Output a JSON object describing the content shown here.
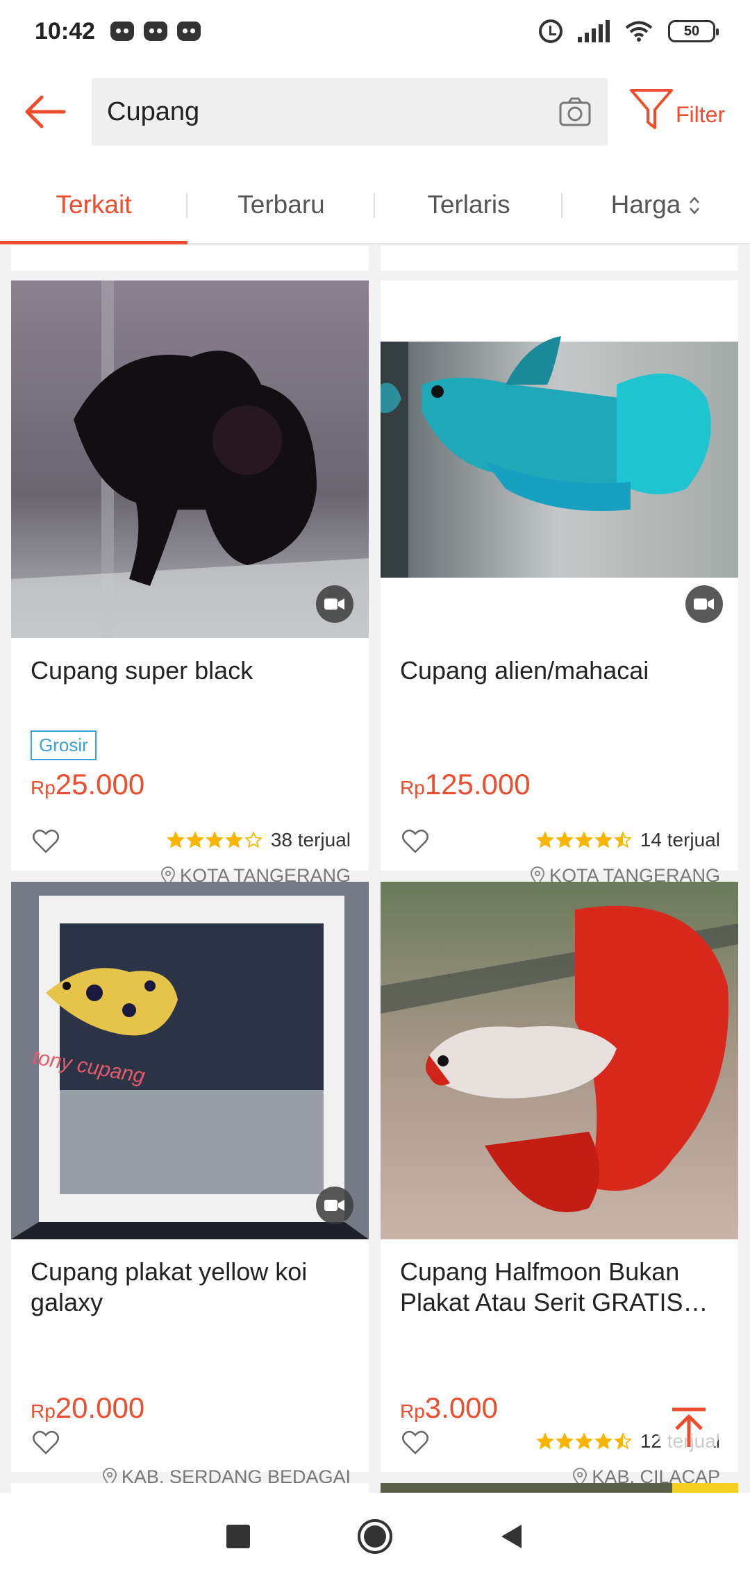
{
  "status_bar": {
    "time": "10:42",
    "notifications": [
      "discord-icon",
      "discord-icon",
      "discord-icon"
    ],
    "battery": "50"
  },
  "search": {
    "query": "Cupang",
    "filter_label": "Filter"
  },
  "tabs": [
    {
      "label": "Terkait",
      "active": true
    },
    {
      "label": "Terbaru",
      "active": false
    },
    {
      "label": "Terlaris",
      "active": false
    },
    {
      "label": "Harga",
      "active": false
    }
  ],
  "products": [
    {
      "title": "Cupang super black",
      "badge": "Grosir",
      "currency": "Rp",
      "price": "25.000",
      "rating": 4,
      "sold": "38 terjual",
      "location": "KOTA TANGERANG",
      "has_video": true
    },
    {
      "title": "Cupang alien/mahacai",
      "badge": "",
      "currency": "Rp",
      "price": "125.000",
      "rating": 4.5,
      "sold": "14 terjual",
      "location": "KOTA TANGERANG",
      "has_video": true
    },
    {
      "title": "Cupang plakat yellow koi galaxy",
      "badge": "",
      "currency": "Rp",
      "price": "20.000",
      "rating": 0,
      "sold": "",
      "location": "KAB. SERDANG BEDAGAI",
      "has_video": true,
      "image_caption": "tony cupang"
    },
    {
      "title": "Cupang Halfmoon Bukan Plakat Atau Serit GRATIS…",
      "badge": "",
      "currency": "Rp",
      "price": "3.000",
      "rating": 4.5,
      "sold": "12 terjual",
      "location": "KAB. CILACAP",
      "has_video": false
    }
  ],
  "colors": {
    "accent": "#ee4d2d",
    "star": "#f7b500",
    "badge_blue": "#3aa0d9"
  }
}
